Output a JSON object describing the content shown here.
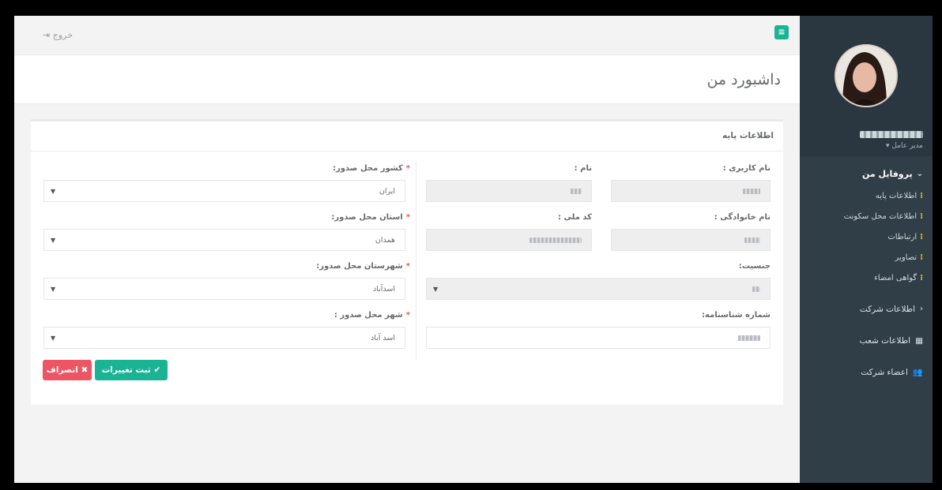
{
  "topbar": {
    "logout_label": "خروج",
    "logout_icon": "sign-out-icon",
    "menu_icon": "bars-icon"
  },
  "page": {
    "title": "داشبورد من"
  },
  "sidebar": {
    "user_role": "مدیر عامل ▾",
    "profile_section": "پروفایل من",
    "profile_items": [
      {
        "label": "اطلاعات پایه"
      },
      {
        "label": "اطلاعات محل سکونت"
      },
      {
        "label": "ارتباطات"
      },
      {
        "label": "تصاویر"
      },
      {
        "label": "گواهی امضاء"
      }
    ],
    "company_info": "اطلاعات شرکت",
    "branches": "اطلاعات شعب",
    "members": "اعضاء شرکت"
  },
  "form": {
    "box_title": "اطلاعات پایه",
    "username_label": "نام کاربری :",
    "first_name_label": "نام :",
    "country_label": "کشور محل صدور:",
    "country_value": "ایران",
    "family_label": "نام خانوادگی :",
    "national_code_label": "کد ملی :",
    "province_label": "استان محل صدور:",
    "province_value": "همدان",
    "gender_label": "جنسیت:",
    "county_label": "شهرستان محل صدور:",
    "county_value": "اسدآباد",
    "birth_cert_label": "شماره شناسنامه:",
    "city_label": "شهر محل صدور :",
    "city_value": "اسد آباد",
    "save_label": "ثبت تغییرات",
    "cancel_label": "انصراف"
  }
}
